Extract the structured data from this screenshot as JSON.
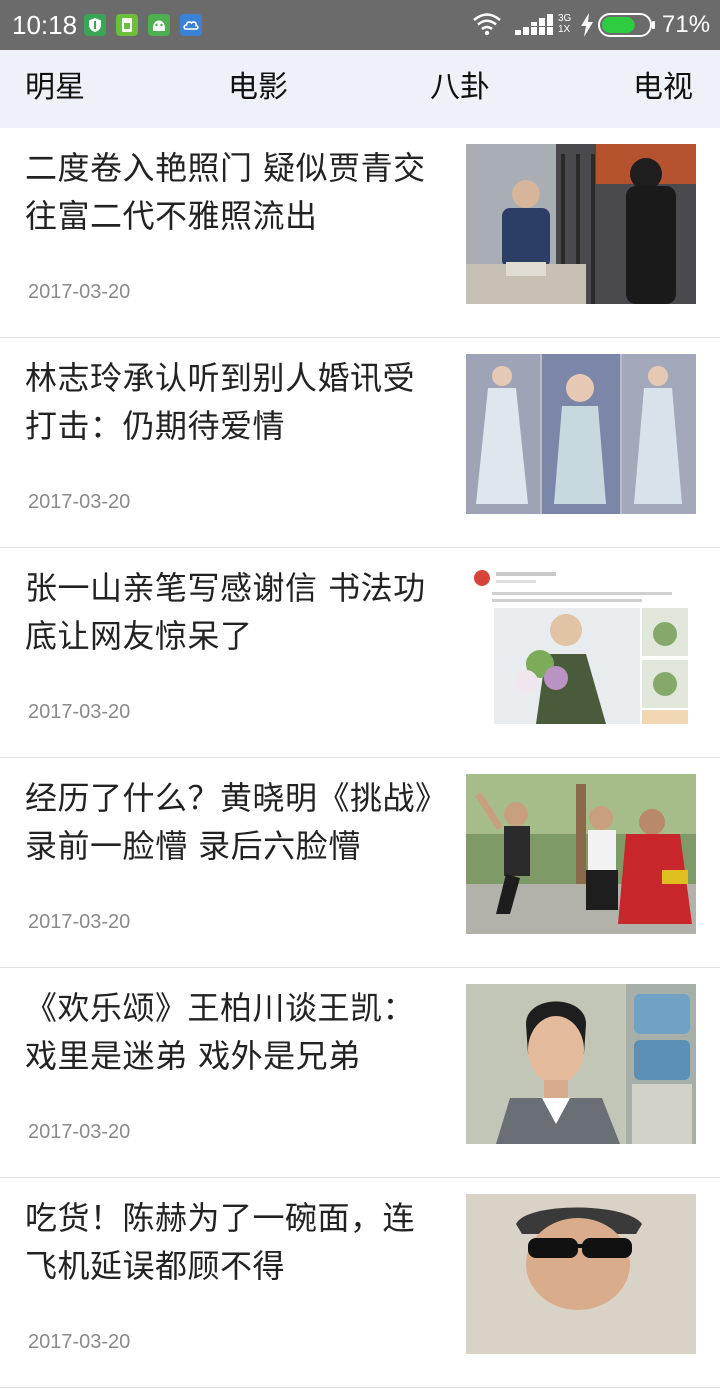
{
  "status_bar": {
    "time": "10:18",
    "network_type": "3G\n1X",
    "battery_percent": "71%",
    "battery_level": 0.71,
    "app_icons": [
      "shield-icon",
      "sim-card-icon",
      "android-icon",
      "cloud-icon"
    ],
    "app_icon_colors": [
      "#3aa655",
      "#6cbf3a",
      "#4caf50",
      "#3b82d6"
    ]
  },
  "tabs": [
    {
      "label": "明星"
    },
    {
      "label": "电影"
    },
    {
      "label": "八卦"
    },
    {
      "label": "电视"
    }
  ],
  "news": [
    {
      "title": "二度卷入艳照门 疑似贾青交往富二代不雅照流出",
      "date": "2017-03-20"
    },
    {
      "title": "林志玲承认听到别人婚讯受打击：仍期待爱情",
      "date": "2017-03-20"
    },
    {
      "title": "张一山亲笔写感谢信 书法功底让网友惊呆了",
      "date": "2017-03-20"
    },
    {
      "title": "经历了什么？黄晓明《挑战》录前一脸懵 录后六脸懵",
      "date": "2017-03-20"
    },
    {
      "title": "《欢乐颂》王柏川谈王凯：戏里是迷弟 戏外是兄弟",
      "date": "2017-03-20"
    },
    {
      "title": "吃货！陈赫为了一碗面，连飞机延误都顾不得",
      "date": "2017-03-20"
    }
  ],
  "colors": {
    "status_bar_bg": "#6b6b6b",
    "tab_bar_bg": "#eef2f8",
    "battery_fill": "#2ecc40",
    "date_text": "#8a8a8a"
  }
}
